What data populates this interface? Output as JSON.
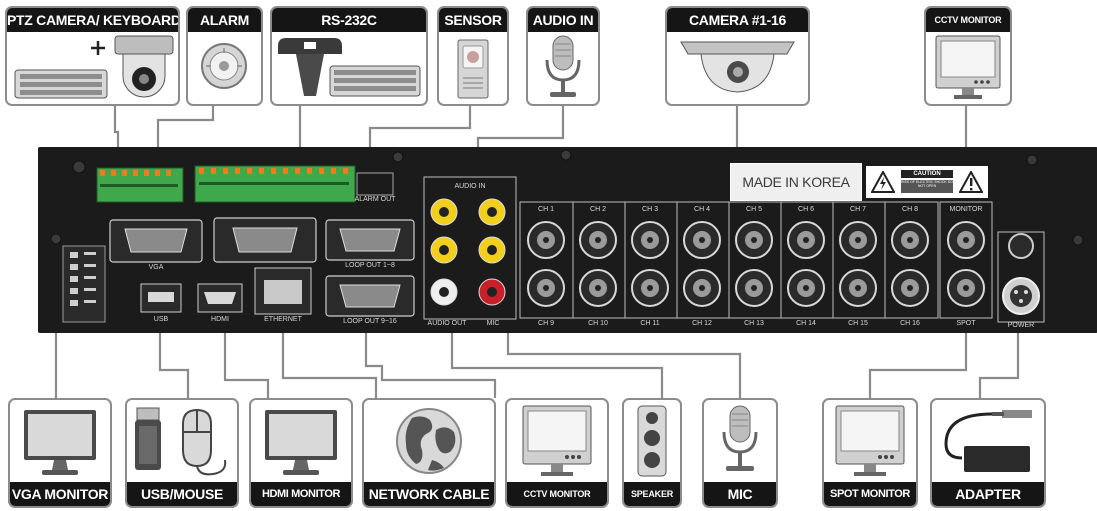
{
  "top_devices": [
    {
      "key": "ptz",
      "label": "PTZ CAMERA/ KEYBOARD"
    },
    {
      "key": "alarm",
      "label": "ALARM"
    },
    {
      "key": "rs232",
      "label": "RS-232C"
    },
    {
      "key": "sensor",
      "label": "SENSOR"
    },
    {
      "key": "audio_in",
      "label": "AUDIO IN"
    },
    {
      "key": "camera",
      "label": "CAMERA #1-16"
    },
    {
      "key": "cctv_top",
      "label": "CCTV MONITOR"
    }
  ],
  "bottom_devices": [
    {
      "key": "vga",
      "label": "VGA MONITOR"
    },
    {
      "key": "usb",
      "label": "USB/MOUSE"
    },
    {
      "key": "hdmi",
      "label": "HDMI MONITOR"
    },
    {
      "key": "network",
      "label": "NETWORK CABLE"
    },
    {
      "key": "cctv_bottom",
      "label": "CCTV MONITOR"
    },
    {
      "key": "speaker",
      "label": "SPEAKER"
    },
    {
      "key": "mic",
      "label": "MIC"
    },
    {
      "key": "spot",
      "label": "SPOT MONITOR"
    },
    {
      "key": "adapter",
      "label": "ADAPTER"
    }
  ],
  "panel": {
    "made_in": "MADE IN KOREA",
    "caution": "CAUTION",
    "caution_text": "RISK OF ELECTRIC SHOCK DO NOT OPEN",
    "audio_in_label": "AUDIO IN",
    "alarm_out_label": "ALARM OUT",
    "vga_label": "VGA",
    "loopout_label": "LOOP OUT 1~8",
    "loopout2_label": "LOOP OUT 9~16",
    "usb_label": "USB",
    "hdmi_label": "HDMI",
    "ethernet_label": "ETHERNET",
    "audio_out_label": "AUDIO OUT",
    "mic_label": "MIC",
    "monitor_label": "MONITOR",
    "spot_label": "SPOT",
    "power_label": "POWER",
    "ch_top": [
      "CH 1",
      "CH 2",
      "CH 3",
      "CH 4",
      "CH 5",
      "CH 6",
      "CH 7",
      "CH 8"
    ],
    "ch_bottom": [
      "CH 9",
      "CH 10",
      "CH 11",
      "CH 12",
      "CH 13",
      "CH 14",
      "CH 15",
      "CH 16"
    ]
  },
  "colors": {
    "label_bg": "#151515",
    "panel": "#1b1b1b",
    "terminal_green": "#3fa84a",
    "rca_yellow": "#f2cf1d",
    "rca_red": "#c8202a"
  }
}
